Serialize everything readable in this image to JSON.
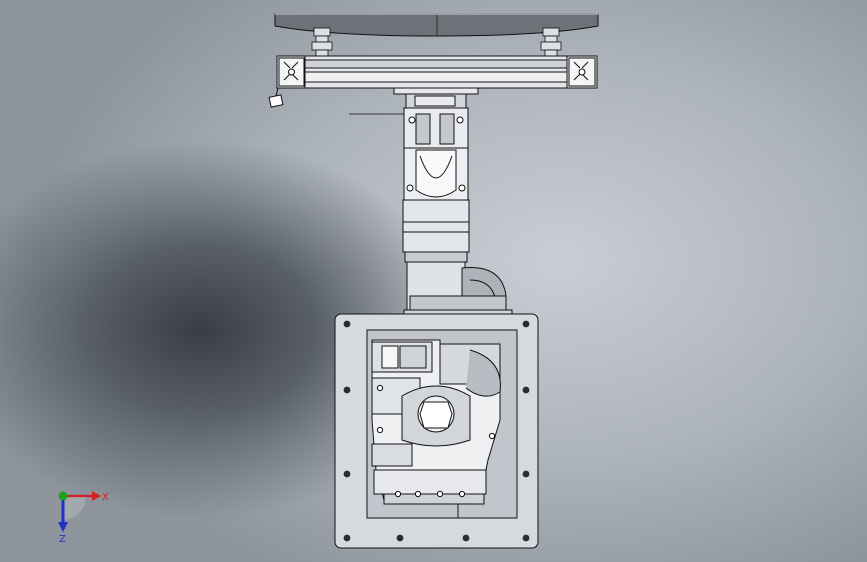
{
  "viewport": {
    "background_top": "#d3d7dc",
    "background_shadow": "#3a3e44"
  },
  "model": {
    "line_color": "#1a1a1a",
    "part_fill": "#e9ebee",
    "shade_fill": "#b9bdc3",
    "plate_fill": "#d8dbe0"
  },
  "triad": {
    "x_label": "X",
    "z_label": "Z",
    "x_color": "#d42020",
    "y_color": "#1fa01f",
    "z_color": "#2030c8",
    "icons": [
      "x-axis-arrow-icon",
      "y-axis-dot-icon",
      "z-axis-arrow-icon"
    ]
  }
}
